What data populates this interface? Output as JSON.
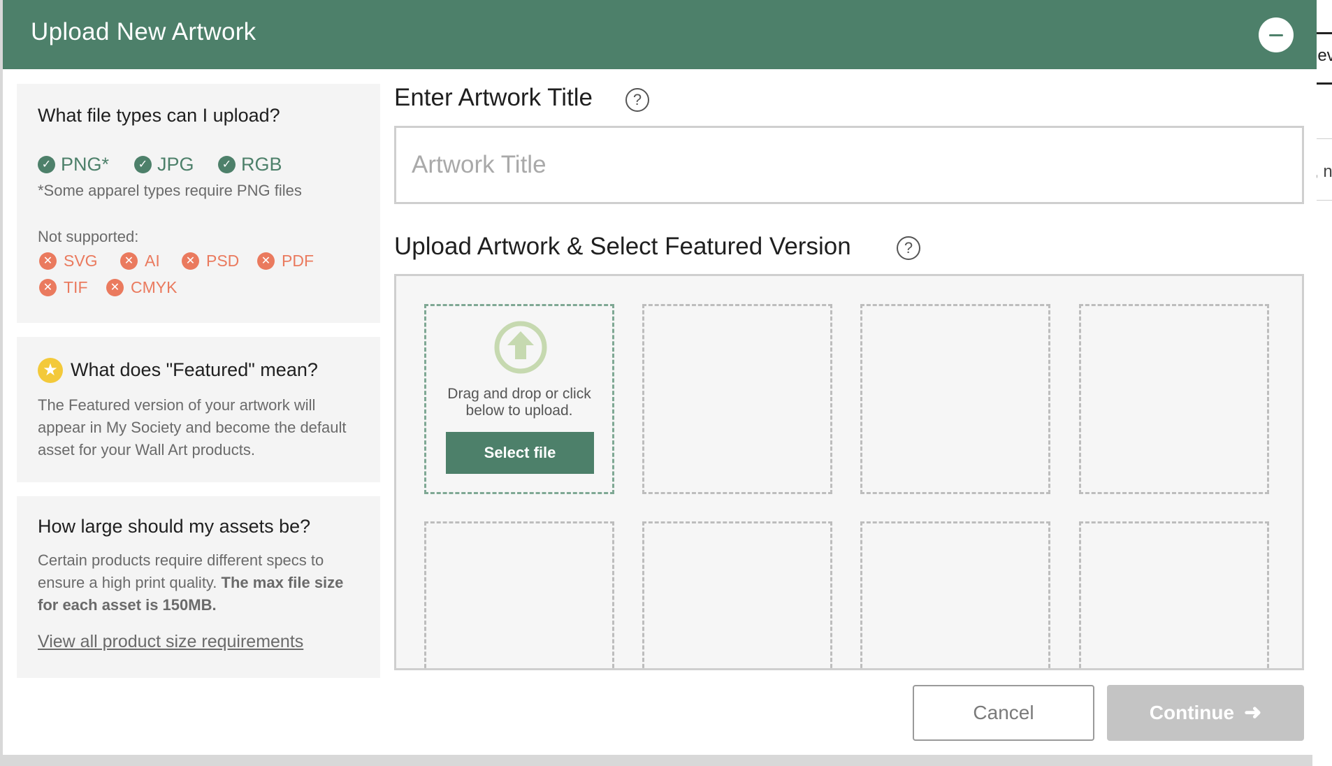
{
  "background": {
    "text1": "lev",
    "text2": ", n"
  },
  "header": {
    "title": "Upload New Artwork",
    "close_icon": "minus-circle-icon"
  },
  "file_types": {
    "heading": "What file types can I upload?",
    "supported": [
      "PNG*",
      "JPG",
      "RGB"
    ],
    "supported_note": "*Some apparel types require PNG files",
    "not_supported_label": "Not supported:",
    "not_supported": [
      "SVG",
      "AI",
      "PSD",
      "PDF",
      "TIF",
      "CMYK"
    ]
  },
  "featured": {
    "heading": "What does \"Featured\" mean?",
    "body": "The Featured version of your artwork will appear in My Society and become the default asset for your Wall Art products."
  },
  "asset_size": {
    "heading": "How large should my assets be?",
    "body": "Certain products require different specs to ensure a high print quality.",
    "body_bold": "The max file size for each asset is 150MB.",
    "link": "View all product size requirements"
  },
  "title_section": {
    "label": "Enter Artwork Title",
    "placeholder": "Artwork Title",
    "value": ""
  },
  "upload_section": {
    "label": "Upload Artwork & Select Featured Version",
    "drop_text": "Drag and drop or click below to upload.",
    "select_button": "Select file"
  },
  "footer": {
    "cancel": "Cancel",
    "continue": "Continue"
  },
  "colors": {
    "brand_green": "#4d806a",
    "error": "#ea7a5e",
    "star": "#f3c93a",
    "disabled": "#c4c4c4"
  }
}
